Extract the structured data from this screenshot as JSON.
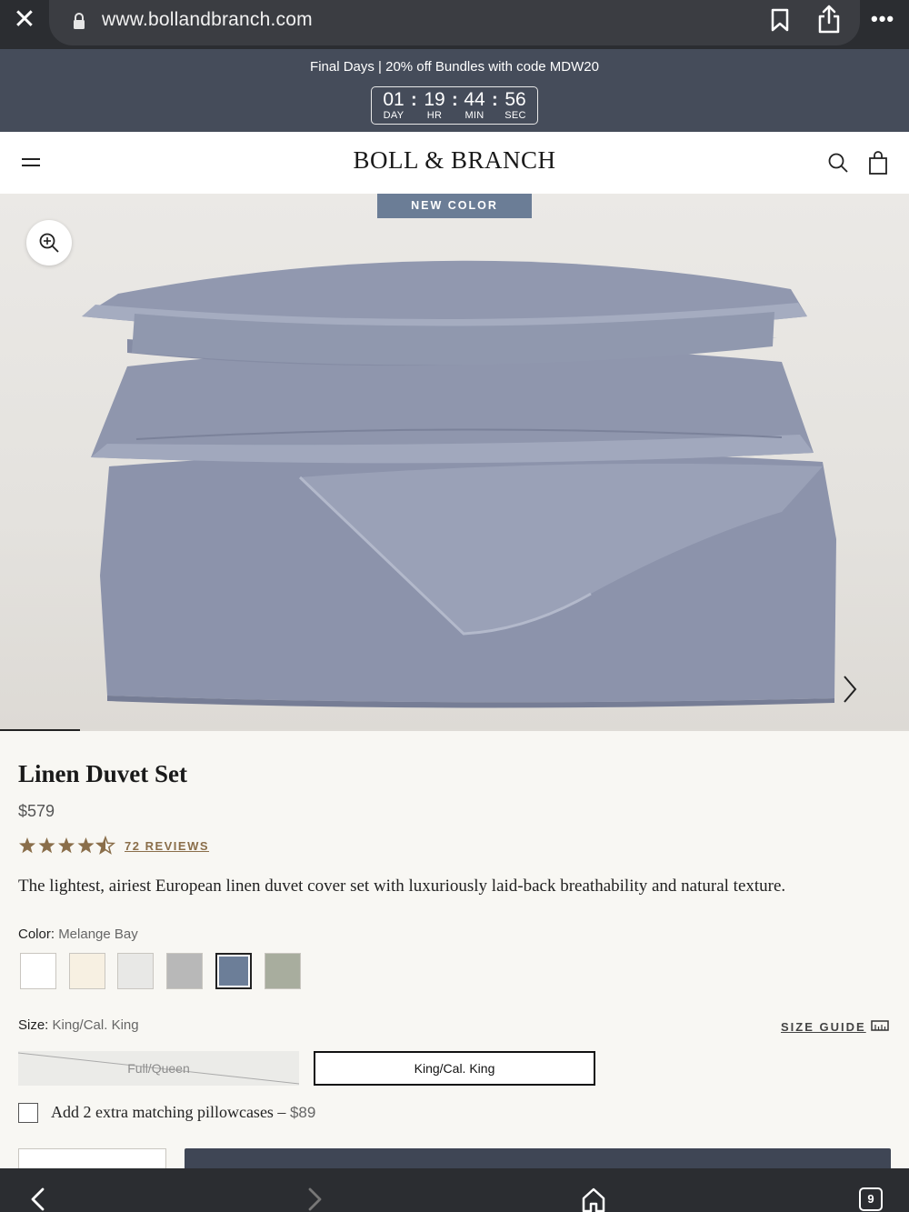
{
  "browser": {
    "url": "www.bollandbranch.com",
    "tab_count": "9"
  },
  "promo": {
    "text": "Final Days | 20% off Bundles with code MDW20",
    "countdown": [
      {
        "value": "01",
        "label": "DAY"
      },
      {
        "value": "19",
        "label": "HR"
      },
      {
        "value": "44",
        "label": "MIN"
      },
      {
        "value": "56",
        "label": "SEC"
      }
    ]
  },
  "header": {
    "logo": "BOLL & BRANCH"
  },
  "hero": {
    "badge": "NEW COLOR",
    "carousel_progress": 0.088,
    "colors": {
      "fabric": "#8e96ae",
      "fabric_dark": "#747c95",
      "fabric_light": "#a4abc0"
    }
  },
  "product": {
    "title": "Linen Duvet Set",
    "price": "$579",
    "rating": 4.5,
    "reviews_label": "72 REVIEWS",
    "description": "The lightest, airiest European linen duvet cover set with luxuriously laid-back breathability and natural texture.",
    "color_label": "Color:",
    "color_value": "Melange Bay",
    "swatches": [
      {
        "hex": "#ffffff",
        "selected": false
      },
      {
        "hex": "#f7f0e2",
        "selected": false
      },
      {
        "hex": "#e8e8e6",
        "selected": false
      },
      {
        "hex": "#b8b8b8",
        "selected": false
      },
      {
        "hex": "#6c7e98",
        "selected": true
      },
      {
        "hex": "#a8ad9e",
        "selected": false
      }
    ],
    "size_label": "Size:",
    "size_value": "King/Cal. King",
    "size_guide": "SIZE GUIDE",
    "sizes": [
      {
        "label": "Full/Queen",
        "available": false
      },
      {
        "label": "King/Cal. King",
        "available": true,
        "selected": true
      }
    ],
    "pillowcase_text": "Add 2 extra matching pillowcases –",
    "pillowcase_price": "$89"
  },
  "theme": {
    "accent": "#6b7d96",
    "star": "#8a6e4a",
    "dark_bar": "#2b2d31",
    "promo_bg": "#454c5a"
  }
}
